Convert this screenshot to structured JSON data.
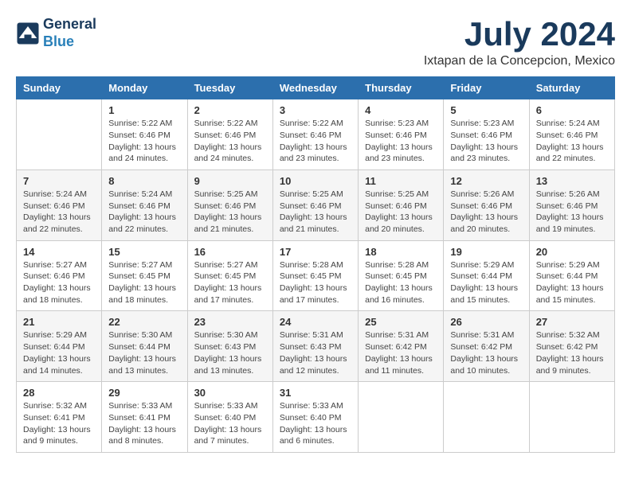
{
  "logo": {
    "text_general": "General",
    "text_blue": "Blue"
  },
  "header": {
    "month_year": "July 2024",
    "location": "Ixtapan de la Concepcion, Mexico"
  },
  "weekdays": [
    "Sunday",
    "Monday",
    "Tuesday",
    "Wednesday",
    "Thursday",
    "Friday",
    "Saturday"
  ],
  "weeks": [
    [
      {
        "day": "",
        "info": ""
      },
      {
        "day": "1",
        "info": "Sunrise: 5:22 AM\nSunset: 6:46 PM\nDaylight: 13 hours\nand 24 minutes."
      },
      {
        "day": "2",
        "info": "Sunrise: 5:22 AM\nSunset: 6:46 PM\nDaylight: 13 hours\nand 24 minutes."
      },
      {
        "day": "3",
        "info": "Sunrise: 5:22 AM\nSunset: 6:46 PM\nDaylight: 13 hours\nand 23 minutes."
      },
      {
        "day": "4",
        "info": "Sunrise: 5:23 AM\nSunset: 6:46 PM\nDaylight: 13 hours\nand 23 minutes."
      },
      {
        "day": "5",
        "info": "Sunrise: 5:23 AM\nSunset: 6:46 PM\nDaylight: 13 hours\nand 23 minutes."
      },
      {
        "day": "6",
        "info": "Sunrise: 5:24 AM\nSunset: 6:46 PM\nDaylight: 13 hours\nand 22 minutes."
      }
    ],
    [
      {
        "day": "7",
        "info": "Sunrise: 5:24 AM\nSunset: 6:46 PM\nDaylight: 13 hours\nand 22 minutes."
      },
      {
        "day": "8",
        "info": "Sunrise: 5:24 AM\nSunset: 6:46 PM\nDaylight: 13 hours\nand 22 minutes."
      },
      {
        "day": "9",
        "info": "Sunrise: 5:25 AM\nSunset: 6:46 PM\nDaylight: 13 hours\nand 21 minutes."
      },
      {
        "day": "10",
        "info": "Sunrise: 5:25 AM\nSunset: 6:46 PM\nDaylight: 13 hours\nand 21 minutes."
      },
      {
        "day": "11",
        "info": "Sunrise: 5:25 AM\nSunset: 6:46 PM\nDaylight: 13 hours\nand 20 minutes."
      },
      {
        "day": "12",
        "info": "Sunrise: 5:26 AM\nSunset: 6:46 PM\nDaylight: 13 hours\nand 20 minutes."
      },
      {
        "day": "13",
        "info": "Sunrise: 5:26 AM\nSunset: 6:46 PM\nDaylight: 13 hours\nand 19 minutes."
      }
    ],
    [
      {
        "day": "14",
        "info": "Sunrise: 5:27 AM\nSunset: 6:46 PM\nDaylight: 13 hours\nand 18 minutes."
      },
      {
        "day": "15",
        "info": "Sunrise: 5:27 AM\nSunset: 6:45 PM\nDaylight: 13 hours\nand 18 minutes."
      },
      {
        "day": "16",
        "info": "Sunrise: 5:27 AM\nSunset: 6:45 PM\nDaylight: 13 hours\nand 17 minutes."
      },
      {
        "day": "17",
        "info": "Sunrise: 5:28 AM\nSunset: 6:45 PM\nDaylight: 13 hours\nand 17 minutes."
      },
      {
        "day": "18",
        "info": "Sunrise: 5:28 AM\nSunset: 6:45 PM\nDaylight: 13 hours\nand 16 minutes."
      },
      {
        "day": "19",
        "info": "Sunrise: 5:29 AM\nSunset: 6:44 PM\nDaylight: 13 hours\nand 15 minutes."
      },
      {
        "day": "20",
        "info": "Sunrise: 5:29 AM\nSunset: 6:44 PM\nDaylight: 13 hours\nand 15 minutes."
      }
    ],
    [
      {
        "day": "21",
        "info": "Sunrise: 5:29 AM\nSunset: 6:44 PM\nDaylight: 13 hours\nand 14 minutes."
      },
      {
        "day": "22",
        "info": "Sunrise: 5:30 AM\nSunset: 6:44 PM\nDaylight: 13 hours\nand 13 minutes."
      },
      {
        "day": "23",
        "info": "Sunrise: 5:30 AM\nSunset: 6:43 PM\nDaylight: 13 hours\nand 13 minutes."
      },
      {
        "day": "24",
        "info": "Sunrise: 5:31 AM\nSunset: 6:43 PM\nDaylight: 13 hours\nand 12 minutes."
      },
      {
        "day": "25",
        "info": "Sunrise: 5:31 AM\nSunset: 6:42 PM\nDaylight: 13 hours\nand 11 minutes."
      },
      {
        "day": "26",
        "info": "Sunrise: 5:31 AM\nSunset: 6:42 PM\nDaylight: 13 hours\nand 10 minutes."
      },
      {
        "day": "27",
        "info": "Sunrise: 5:32 AM\nSunset: 6:42 PM\nDaylight: 13 hours\nand 9 minutes."
      }
    ],
    [
      {
        "day": "28",
        "info": "Sunrise: 5:32 AM\nSunset: 6:41 PM\nDaylight: 13 hours\nand 9 minutes."
      },
      {
        "day": "29",
        "info": "Sunrise: 5:33 AM\nSunset: 6:41 PM\nDaylight: 13 hours\nand 8 minutes."
      },
      {
        "day": "30",
        "info": "Sunrise: 5:33 AM\nSunset: 6:40 PM\nDaylight: 13 hours\nand 7 minutes."
      },
      {
        "day": "31",
        "info": "Sunrise: 5:33 AM\nSunset: 6:40 PM\nDaylight: 13 hours\nand 6 minutes."
      },
      {
        "day": "",
        "info": ""
      },
      {
        "day": "",
        "info": ""
      },
      {
        "day": "",
        "info": ""
      }
    ]
  ]
}
